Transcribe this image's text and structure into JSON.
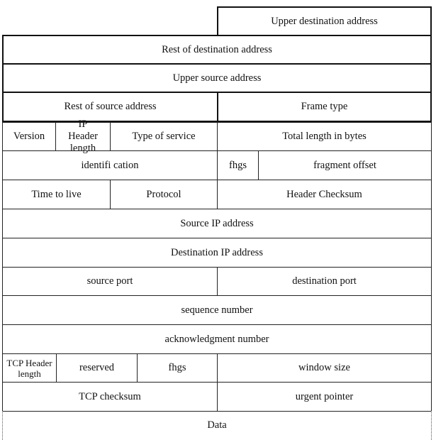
{
  "ethernet_header": {
    "upper_destination_address": "Upper destination address",
    "rest_of_destination_address": "Rest of destination address",
    "upper_source_address": "Upper source address",
    "rest_of_source_address": "Rest of source address",
    "frame_type": "Frame type"
  },
  "ip_header": {
    "version": "Version",
    "ip_header_length": "IP Header length",
    "type_of_service": "Type of service",
    "total_length": "Total length in bytes",
    "identification": "identifi cation",
    "flags": "fhgs",
    "fragment_offset": "fragment offset",
    "time_to_live": "Time to live",
    "protocol": "Protocol",
    "header_checksum": "Header Checksum",
    "source_ip": "Source IP address",
    "destination_ip": "Destination IP address"
  },
  "tcp_header": {
    "source_port": "source port",
    "destination_port": "destination port",
    "sequence_number": "sequence number",
    "acknowledgment_number": "acknowledgment number",
    "tcp_header_length": "TCP Header length",
    "reserved": "reserved",
    "flags": "fhgs",
    "window_size": "window size",
    "tcp_checksum": "TCP checksum",
    "urgent_pointer": "urgent pointer"
  },
  "payload": {
    "data": "Data"
  }
}
